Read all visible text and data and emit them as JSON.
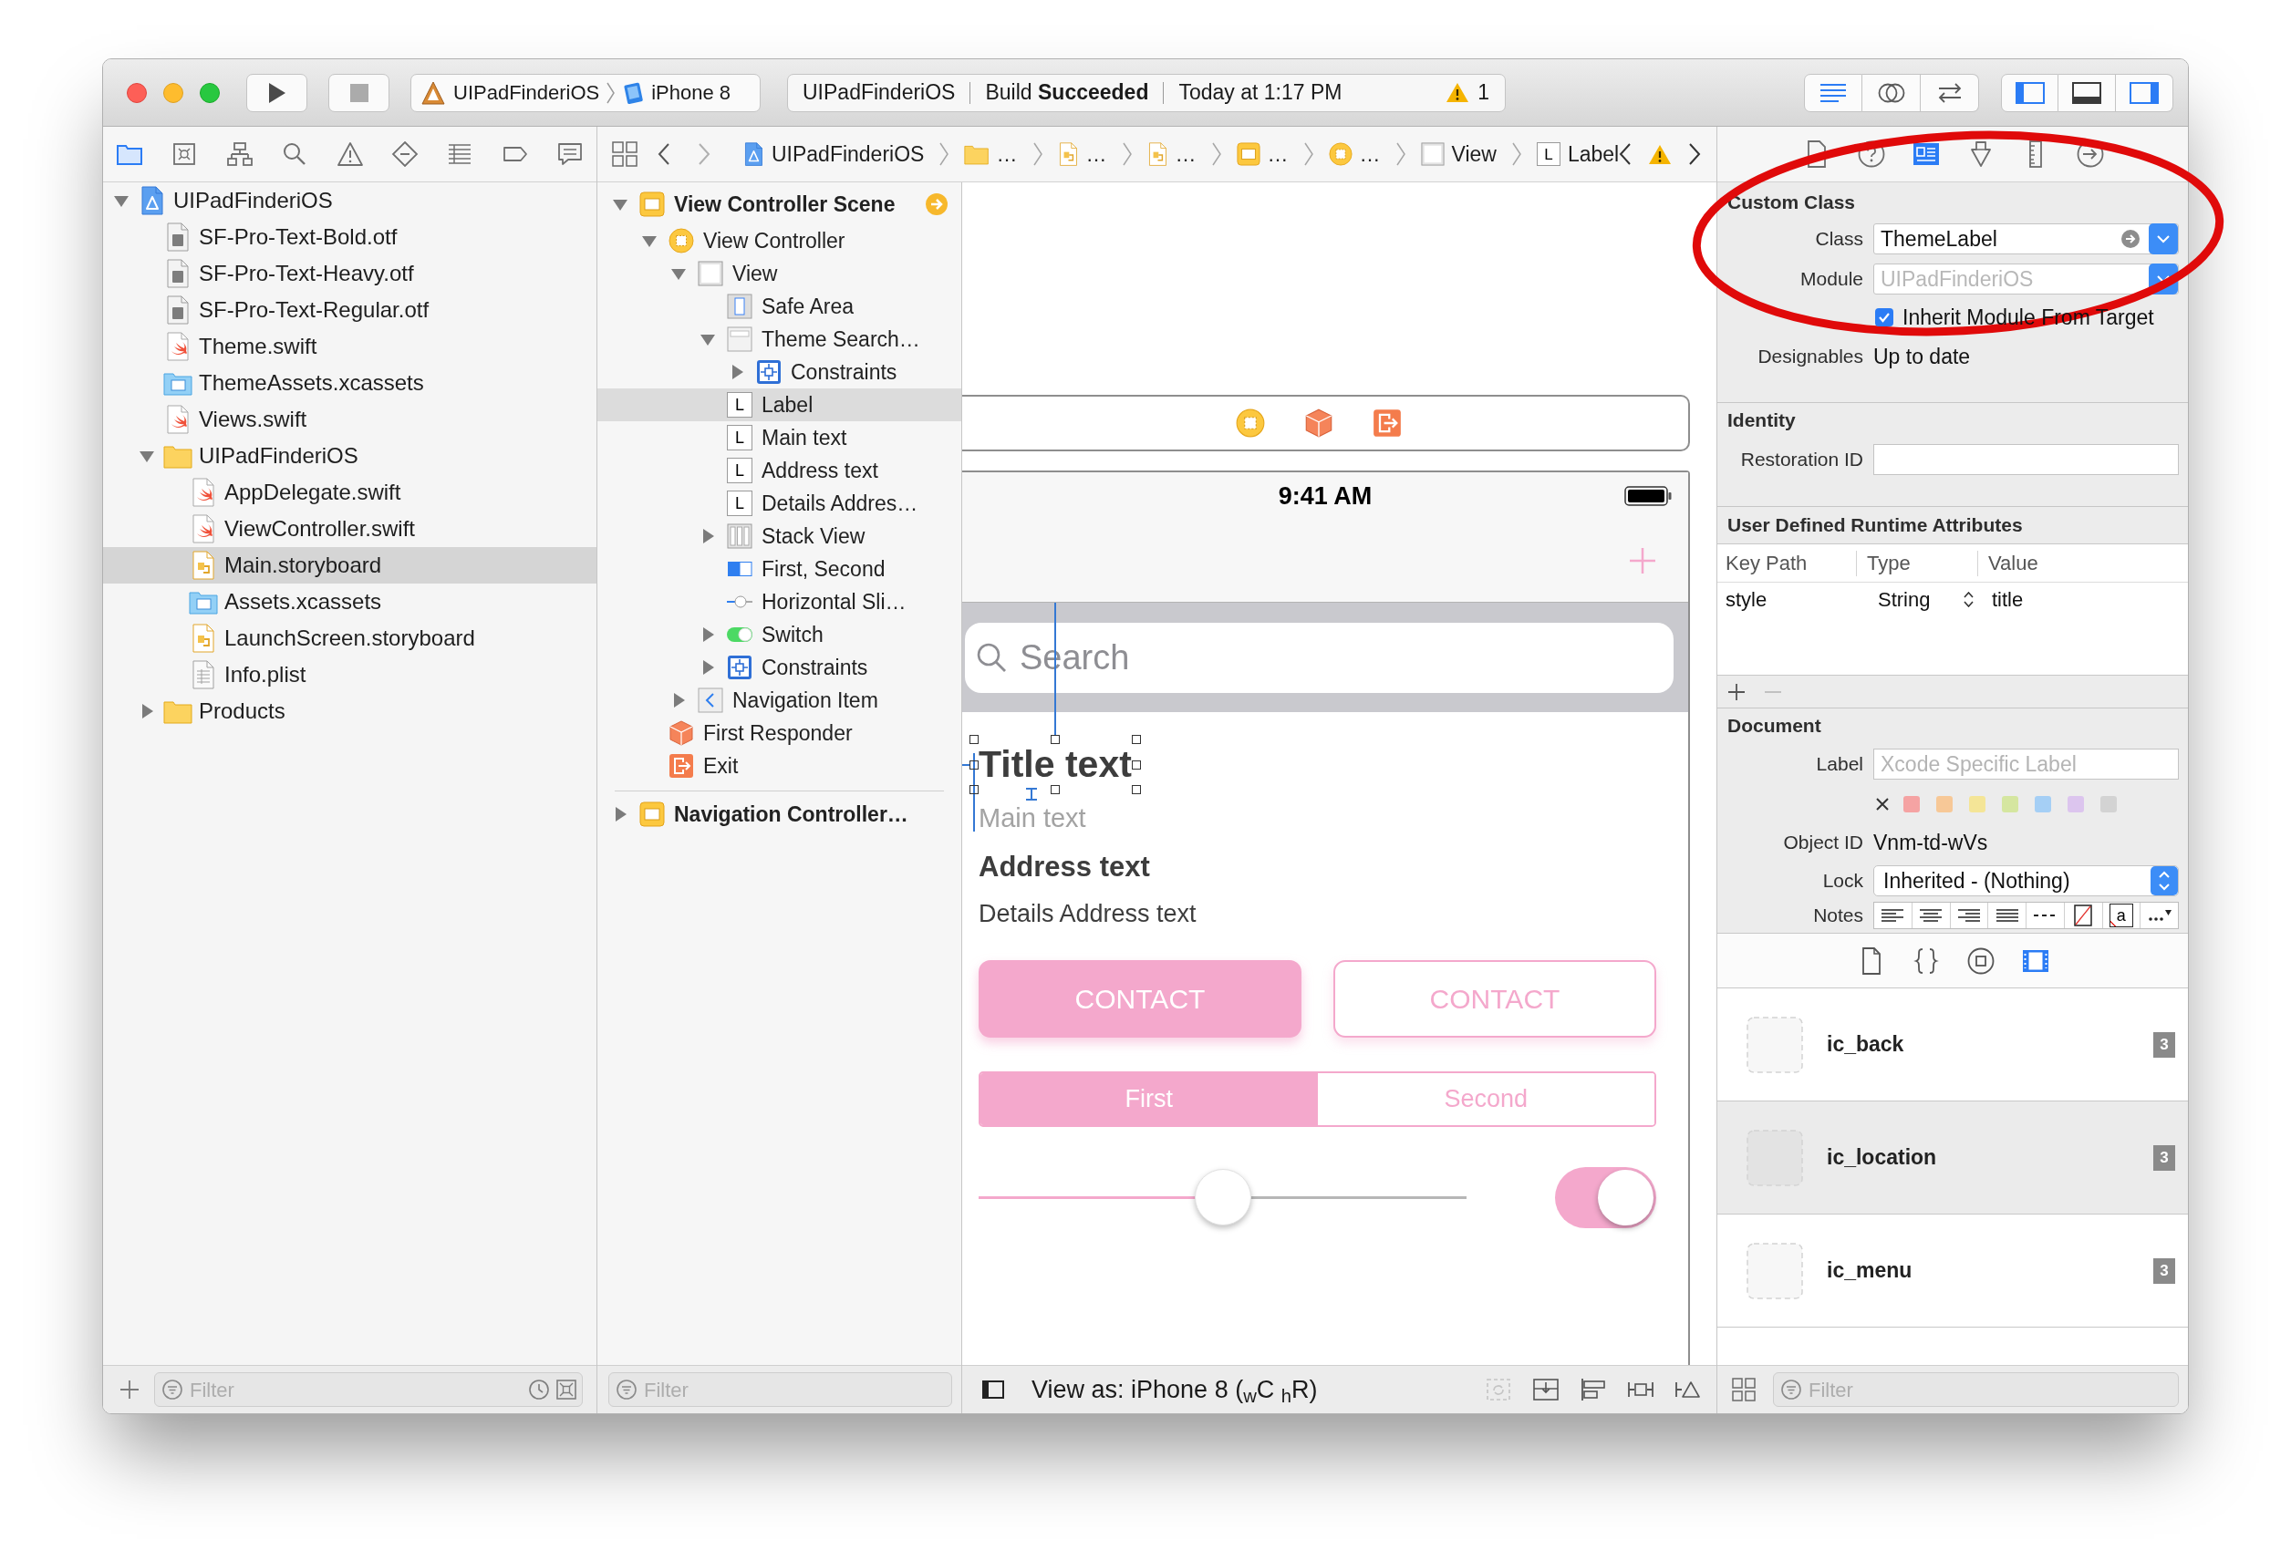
{
  "toolbar": {
    "scheme": {
      "project": "UIPadFinderiOS",
      "device": "iPhone 8"
    },
    "activity": {
      "project": "UIPadFinderiOS",
      "status": "Build **Succeeded**",
      "time": "Today at 1:17 PM",
      "warnings": "1"
    },
    "editor_modes": [
      {
        "kind": "standard",
        "selected": true
      },
      {
        "kind": "assistant",
        "selected": false
      },
      {
        "kind": "version",
        "selected": false
      }
    ],
    "panels": [
      {
        "kind": "navigator",
        "on": true
      },
      {
        "kind": "debug",
        "on": false
      },
      {
        "kind": "utilities",
        "on": true
      }
    ]
  },
  "navigator": {
    "tabs": [
      {
        "kind": "project",
        "selected": true
      },
      {
        "kind": "source_control",
        "selected": false
      },
      {
        "kind": "symbol",
        "selected": false
      },
      {
        "kind": "find",
        "selected": false
      },
      {
        "kind": "issue",
        "selected": false
      },
      {
        "kind": "test",
        "selected": false
      },
      {
        "kind": "debug",
        "selected": false
      },
      {
        "kind": "breakpoint",
        "selected": false
      },
      {
        "kind": "report",
        "selected": false
      }
    ],
    "tree": [
      {
        "label": "UIPadFinderiOS",
        "kind": "project",
        "selected": false,
        "expanded": true,
        "children": [
          {
            "label": "SF-Pro-Text-Bold.otf",
            "kind": "font",
            "selected": false
          },
          {
            "label": "SF-Pro-Text-Heavy.otf",
            "kind": "font",
            "selected": false
          },
          {
            "label": "SF-Pro-Text-Regular.otf",
            "kind": "font",
            "selected": false
          },
          {
            "label": "Theme.swift",
            "kind": "swift",
            "selected": false
          },
          {
            "label": "ThemeAssets.xcassets",
            "kind": "assets",
            "selected": false
          },
          {
            "label": "Views.swift",
            "kind": "swift",
            "selected": false
          },
          {
            "label": "UIPadFinderiOS",
            "kind": "folder",
            "selected": false,
            "expanded": true,
            "children": [
              {
                "label": "AppDelegate.swift",
                "kind": "swift",
                "selected": false
              },
              {
                "label": "ViewController.swift",
                "kind": "swift",
                "selected": false
              },
              {
                "label": "Main.storyboard",
                "kind": "storyboard",
                "selected": true
              },
              {
                "label": "Assets.xcassets",
                "kind": "assets",
                "selected": false
              },
              {
                "label": "LaunchScreen.storyboard",
                "kind": "storyboard",
                "selected": false
              },
              {
                "label": "Info.plist",
                "kind": "plist",
                "selected": false
              }
            ]
          },
          {
            "label": "Products",
            "kind": "folder",
            "selected": false,
            "expanded": false
          }
        ]
      }
    ],
    "filter_placeholder": "Filter"
  },
  "jump_bar": [
    {
      "kind": "project",
      "label": "UIPadFinderiOS"
    },
    {
      "kind": "folder",
      "label": "…"
    },
    {
      "kind": "storyboard",
      "label": "…"
    },
    {
      "kind": "storyboard",
      "label": "…"
    },
    {
      "kind": "scene",
      "label": "…"
    },
    {
      "kind": "view_controller",
      "label": "…"
    },
    {
      "kind": "view",
      "label": "View"
    },
    {
      "kind": "label",
      "glyph": "L",
      "label": "Label"
    }
  ],
  "outline": {
    "items": [
      {
        "kind": "scene",
        "label": "View Controller Scene",
        "initial": true,
        "selected": false,
        "expanded": true,
        "children": [
          {
            "kind": "view_controller",
            "label": "View Controller",
            "selected": false,
            "expanded": true,
            "children": [
              {
                "kind": "view",
                "label": "View",
                "selected": false,
                "expanded": true,
                "children": [
                  {
                    "kind": "safe_area",
                    "label": "Safe Area",
                    "selected": false
                  },
                  {
                    "kind": "search_bar",
                    "label": "Theme Search…",
                    "selected": false,
                    "expanded": true,
                    "children": [
                      {
                        "kind": "constraints",
                        "label": "Constraints",
                        "selected": false,
                        "expanded": false
                      }
                    ]
                  },
                  {
                    "kind": "label",
                    "glyph": "L",
                    "label": "Label",
                    "selected": true
                  },
                  {
                    "kind": "label",
                    "glyph": "L",
                    "label": "Main text",
                    "selected": false
                  },
                  {
                    "kind": "label",
                    "glyph": "L",
                    "label": "Address text",
                    "selected": false
                  },
                  {
                    "kind": "label",
                    "glyph": "L",
                    "label": "Details Addres…",
                    "selected": false
                  },
                  {
                    "kind": "stack_view",
                    "label": "Stack View",
                    "selected": false,
                    "expanded": false
                  },
                  {
                    "kind": "segmented_control",
                    "label": "First, Second",
                    "selected": false
                  },
                  {
                    "kind": "slider",
                    "label": "Horizontal Sli…",
                    "selected": false
                  },
                  {
                    "kind": "switch",
                    "label": "Switch",
                    "selected": false,
                    "expanded": false
                  },
                  {
                    "kind": "constraints",
                    "label": "Constraints",
                    "selected": false,
                    "expanded": false
                  }
                ]
              },
              {
                "kind": "navigation_item",
                "label": "Navigation Item",
                "selected": false,
                "expanded": false
              }
            ]
          },
          {
            "kind": "first_responder",
            "label": "First Responder",
            "selected": false
          },
          {
            "kind": "exit",
            "label": "Exit",
            "selected": false
          }
        ]
      },
      {
        "kind": "scene",
        "label": "Navigation Controller…",
        "initial": false,
        "selected": false,
        "expanded": false
      }
    ],
    "filter_placeholder": "Filter"
  },
  "canvas": {
    "dock": [
      {
        "kind": "view_controller"
      },
      {
        "kind": "first_responder"
      },
      {
        "kind": "exit"
      }
    ],
    "device": {
      "time": "9:41 AM",
      "search_placeholder": "Search",
      "labels": [
        {
          "kind": "title",
          "text": "Title text",
          "selected": true
        },
        {
          "kind": "body",
          "text": "Main text",
          "selected": false
        },
        {
          "kind": "heading",
          "text": "Address text",
          "selected": false
        },
        {
          "kind": "detail",
          "text": "Details Address text",
          "selected": false
        }
      ],
      "buttons": [
        {
          "kind": "filled",
          "label": "CONTACT"
        },
        {
          "kind": "outline",
          "label": "CONTACT"
        }
      ],
      "segments": [
        {
          "label": "First",
          "selected": true
        },
        {
          "label": "Second",
          "selected": false
        }
      ],
      "slider": {
        "level": 0.5
      },
      "switch": {
        "on": true
      }
    },
    "view_as": "View as: iPhone 8 ($_{w}$C $_{h}$R)"
  },
  "inspector": {
    "tabs": [
      {
        "kind": "file",
        "selected": false
      },
      {
        "kind": "help",
        "selected": false
      },
      {
        "kind": "identity",
        "selected": true
      },
      {
        "kind": "attributes",
        "selected": false
      },
      {
        "kind": "size",
        "selected": false
      },
      {
        "kind": "connections",
        "selected": false
      }
    ],
    "custom_class": {
      "title": "Custom Class",
      "class_label": "Class",
      "class_value": "ThemeLabel",
      "module_label": "Module",
      "module_placeholder": "UIPadFinderiOS",
      "inherit_label": "Inherit Module From Target",
      "inherit_checked": true,
      "designables_label": "Designables",
      "designables_value": "Up to date"
    },
    "identity": {
      "title": "Identity",
      "restoration_label": "Restoration ID"
    },
    "runtime_attributes": {
      "title": "User Defined Runtime Attributes",
      "columns": [
        "Key Path",
        "Type",
        "Value"
      ],
      "rows": [
        {
          "key_path": "style",
          "type": "String",
          "value": "title"
        }
      ]
    },
    "document": {
      "title": "Document",
      "label_label": "Label",
      "label_placeholder": "Xcode Specific Label",
      "colors": [
        {
          "color": "#f5a3a3"
        },
        {
          "color": "#f7c897"
        },
        {
          "color": "#f4e597"
        },
        {
          "color": "#d5e6a0"
        },
        {
          "color": "#a5cff5"
        },
        {
          "color": "#dcc5ee"
        },
        {
          "color": "#d3d3d3"
        }
      ],
      "object_id_label": "Object ID",
      "object_id": "Vnm-td-wVs",
      "lock_label": "Lock",
      "lock_value": "Inherited - (Nothing)",
      "notes_label": "Notes",
      "notes_tools": [
        {
          "kind": "align_left"
        },
        {
          "kind": "align_center"
        },
        {
          "kind": "align_right"
        },
        {
          "kind": "justify"
        },
        {
          "kind": "separator_line"
        },
        {
          "kind": "no_color"
        },
        {
          "kind": "text_color",
          "glyph": "a"
        },
        {
          "kind": "more"
        }
      ]
    }
  },
  "library": {
    "tabs": [
      {
        "kind": "file_template",
        "selected": false
      },
      {
        "kind": "code_snippet",
        "selected": false
      },
      {
        "kind": "object",
        "selected": false
      },
      {
        "kind": "media",
        "selected": true
      }
    ],
    "items": [
      {
        "name": "ic_back",
        "count": "3",
        "selected": false
      },
      {
        "name": "ic_location",
        "count": "3",
        "selected": true
      },
      {
        "name": "ic_menu",
        "count": "3",
        "selected": false
      }
    ],
    "filter_placeholder": "Filter"
  },
  "annotation": {
    "kind": "ellipse"
  }
}
